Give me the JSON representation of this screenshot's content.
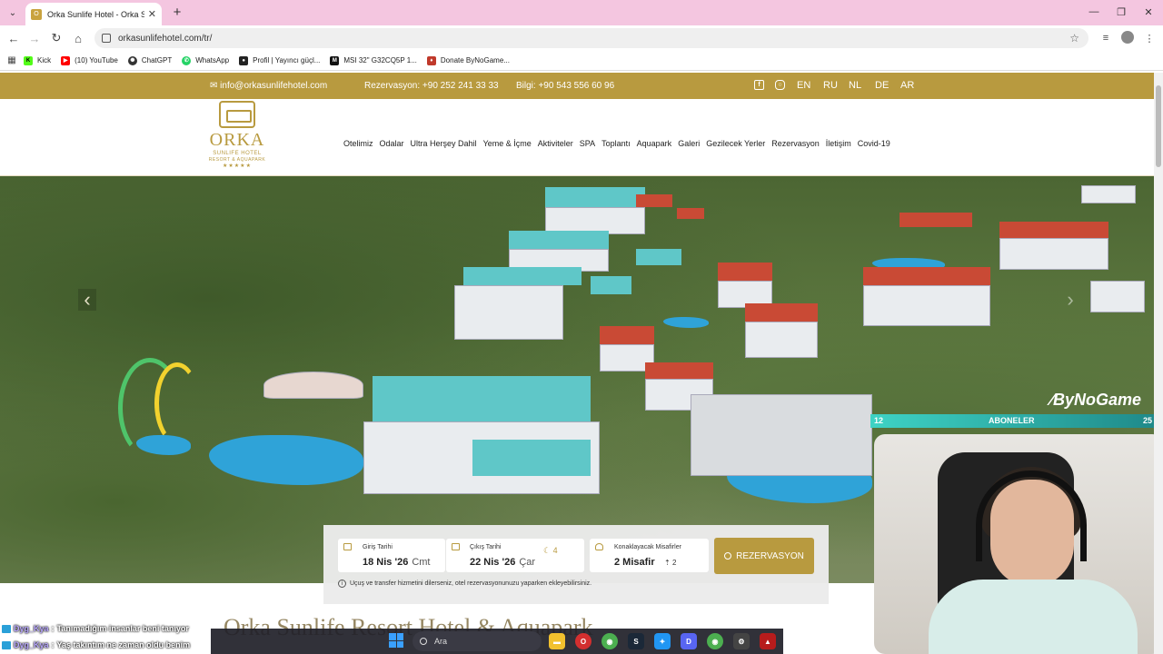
{
  "browser": {
    "tab_title": "Orka Sunlife Hotel - Orka Sunlife Hotel",
    "url": "orkasunlifehotel.com/tr/",
    "bookmarks": [
      {
        "label": "Kick",
        "color": "#53fc18"
      },
      {
        "label": "(10) YouTube",
        "color": "#ff0000"
      },
      {
        "label": "ChatGPT",
        "color": "#333333"
      },
      {
        "label": "WhatsApp",
        "color": "#25d366"
      },
      {
        "label": "Profil | Yayıncı güçl...",
        "color": "#222222"
      },
      {
        "label": "MSI 32\" G32CQ5P 1...",
        "color": "#111111"
      },
      {
        "label": "Donate ByNoGame...",
        "color": "#c0392b"
      }
    ]
  },
  "site": {
    "email": "info@orkasunlifehotel.com",
    "reservation_phone": "Rezervasyon: +90 252 241 33 33",
    "info_phone": "Bilgi: +90 543 556 60 96",
    "languages": [
      "EN",
      "RU",
      "NL",
      "DE",
      "AR"
    ],
    "logo": {
      "name": "ORKA",
      "sub": "SUNLIFE HOTEL",
      "sub2": "RESORT & AQUAPARK",
      "stars": "★★★★★"
    },
    "nav": [
      "Otelimiz",
      "Odalar",
      "Ultra Herşey Dahil",
      "Yeme & İçme",
      "Aktiviteler",
      "SPA",
      "Toplantı",
      "Aquapark",
      "Galeri",
      "Gezilecek Yerler",
      "Rezervasyon",
      "İletişim",
      "Covid-19"
    ],
    "booking": {
      "checkin_label": "Giriş Tarihi",
      "checkin_date": "18 Nis '26",
      "checkin_day": "Cmt",
      "checkout_label": "Çıkış Tarihi",
      "checkout_date": "22 Nis '26",
      "checkout_day": "Çar",
      "nights": "4",
      "guests_label": "Konaklayacak Misafirler",
      "guests_value": "2 Misafir",
      "guests_count": "2",
      "button_label": "REZERVASYON",
      "note": "Uçuş ve transfer hizmetini dilerseniz, otel rezervasyonunuzu yaparken ekleyebilirsiniz."
    },
    "heading_partial": "Orka Sunlife Resort Hotel & Aquapark"
  },
  "stream_overlay": {
    "brand": "ByNoGame",
    "bar_left": "12",
    "bar_center": "ABONELER",
    "bar_right": "25"
  },
  "chat": [
    {
      "user": "Dyg_Kya",
      "message": "Tanımadığım insanlar beni tanıyor"
    },
    {
      "user": "Dyg_Kya",
      "message": "Yaş takıntım ne zaman oldu benim"
    }
  ],
  "taskbar": {
    "search_placeholder": "Ara"
  },
  "colors": {
    "accent_gold": "#b89a3f",
    "tab_strip": "#f4c6e0"
  }
}
